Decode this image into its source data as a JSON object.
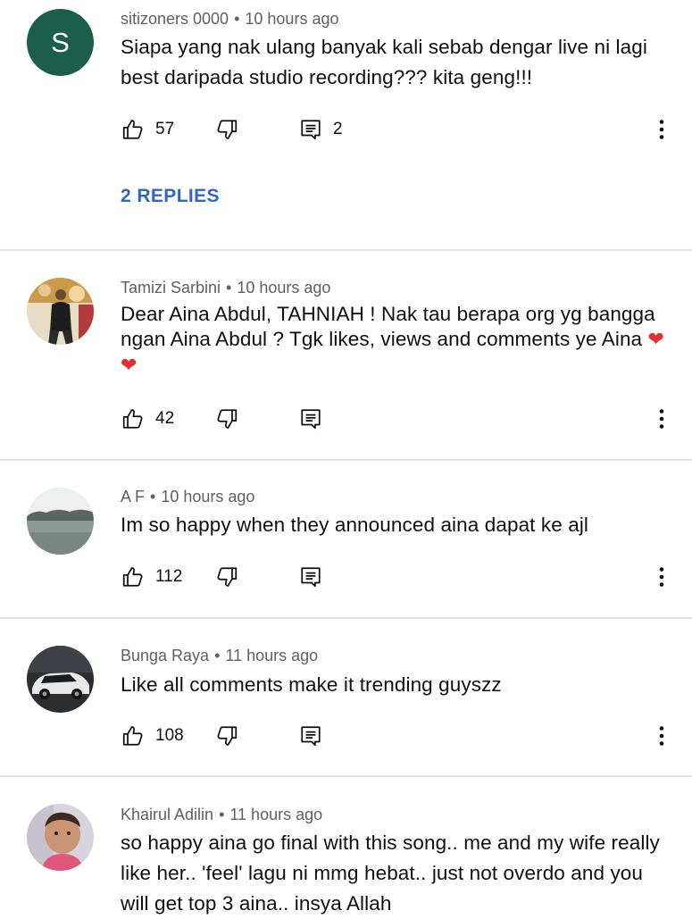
{
  "comments": [
    {
      "author": "sitizoners 0000",
      "time": "10 hours ago",
      "avatar_letter": "S",
      "text_lines": [
        "Siapa yang nak ulang banyak kali sebab dengar live ni lagi",
        "best daripada studio recording??? kita geng!!!"
      ],
      "likes": "57",
      "replies_count": "2",
      "replies_link": "2 REPLIES"
    },
    {
      "author": "Tamizi Sarbini",
      "time": "10 hours ago",
      "text_lines": [
        "Dear Aina Abdul, TAHNIAH ! Nak tau berapa org yg bangga",
        "ngan Aina Abdul ? Tgk likes, views and comments ye Aina"
      ],
      "likes": "42"
    },
    {
      "author": "A F",
      "time": "10 hours ago",
      "text_lines": [
        "Im so happy when they announced aina dapat ke ajl"
      ],
      "likes": "112"
    },
    {
      "author": "Bunga Raya",
      "time": "11 hours ago",
      "text_lines": [
        "Like all comments make it trending guyszz"
      ],
      "likes": "108"
    },
    {
      "author": "Khairul Adilin",
      "time": "11 hours ago",
      "text_lines": [
        "so happy aina go final with this song.. me and my wife really",
        "like her.. 'feel' lagu ni mmg hebat.. just not overdo and you",
        "will get top 3 aina.. insya Allah"
      ]
    }
  ],
  "separator": "•",
  "icons": {
    "like": "thumb-up-icon",
    "dislike": "thumb-down-icon",
    "reply": "reply-comment-icon",
    "more": "more-vertical-icon"
  },
  "colors": {
    "link": "#3265c4",
    "meta": "#606060",
    "heart": "#e0302f",
    "avatar_letter_bg": "#1b5e4a"
  }
}
